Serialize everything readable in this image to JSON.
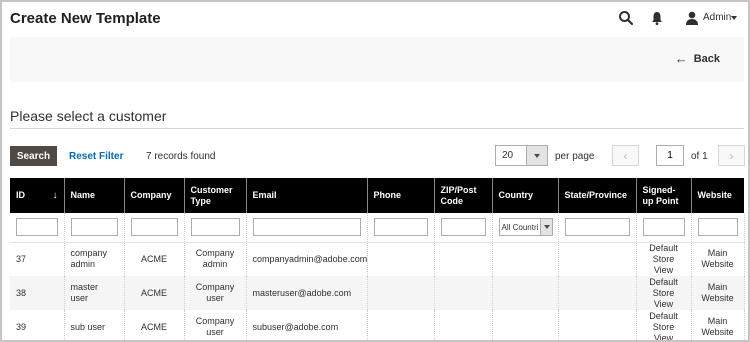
{
  "header": {
    "title": "Create New Template",
    "search_icon": "search-icon",
    "notifications_icon": "bell-icon",
    "user_icon": "user-icon",
    "user_name": "Admin"
  },
  "actions": {
    "back_label": "Back",
    "back_icon": "arrow-left-icon"
  },
  "section": {
    "title": "Please select a customer"
  },
  "toolbar": {
    "search_label": "Search",
    "reset_label": "Reset Filter",
    "records_found": "7 records found",
    "page_size": "20",
    "per_page_label": "per page",
    "prev_icon": "‹",
    "next_icon": "›",
    "current_page": "1",
    "of_pages": "of 1"
  },
  "grid": {
    "columns": [
      {
        "id": "id",
        "label": "ID"
      },
      {
        "id": "name",
        "label": "Name"
      },
      {
        "id": "company",
        "label": "Company"
      },
      {
        "id": "customer_type",
        "label": "Customer Type"
      },
      {
        "id": "email",
        "label": "Email"
      },
      {
        "id": "phone",
        "label": "Phone"
      },
      {
        "id": "zip",
        "label": "ZIP/Post Code"
      },
      {
        "id": "country",
        "label": "Country"
      },
      {
        "id": "state",
        "label": "State/Province"
      },
      {
        "id": "signed_up",
        "label": "Signed-up Point"
      },
      {
        "id": "website",
        "label": "Website"
      }
    ],
    "sort_indicator": "↓",
    "country_filter_value": "All Countri",
    "rows": [
      {
        "id": "37",
        "name": "company admin",
        "company": "ACME",
        "customer_type": "Company admin",
        "email": "companyadmin@adobe.com",
        "phone": "",
        "zip": "",
        "country": "",
        "state": "",
        "signed_up": "Default Store View",
        "website": "Main Website"
      },
      {
        "id": "38",
        "name": "master user",
        "company": "ACME",
        "customer_type": "Company user",
        "email": "masteruser@adobe.com",
        "phone": "",
        "zip": "",
        "country": "",
        "state": "",
        "signed_up": "Default Store View",
        "website": "Main Website"
      },
      {
        "id": "39",
        "name": "sub user",
        "company": "ACME",
        "customer_type": "Company user",
        "email": "subuser@adobe.com",
        "phone": "",
        "zip": "",
        "country": "",
        "state": "",
        "signed_up": "Default Store View",
        "website": "Main Website"
      }
    ]
  }
}
